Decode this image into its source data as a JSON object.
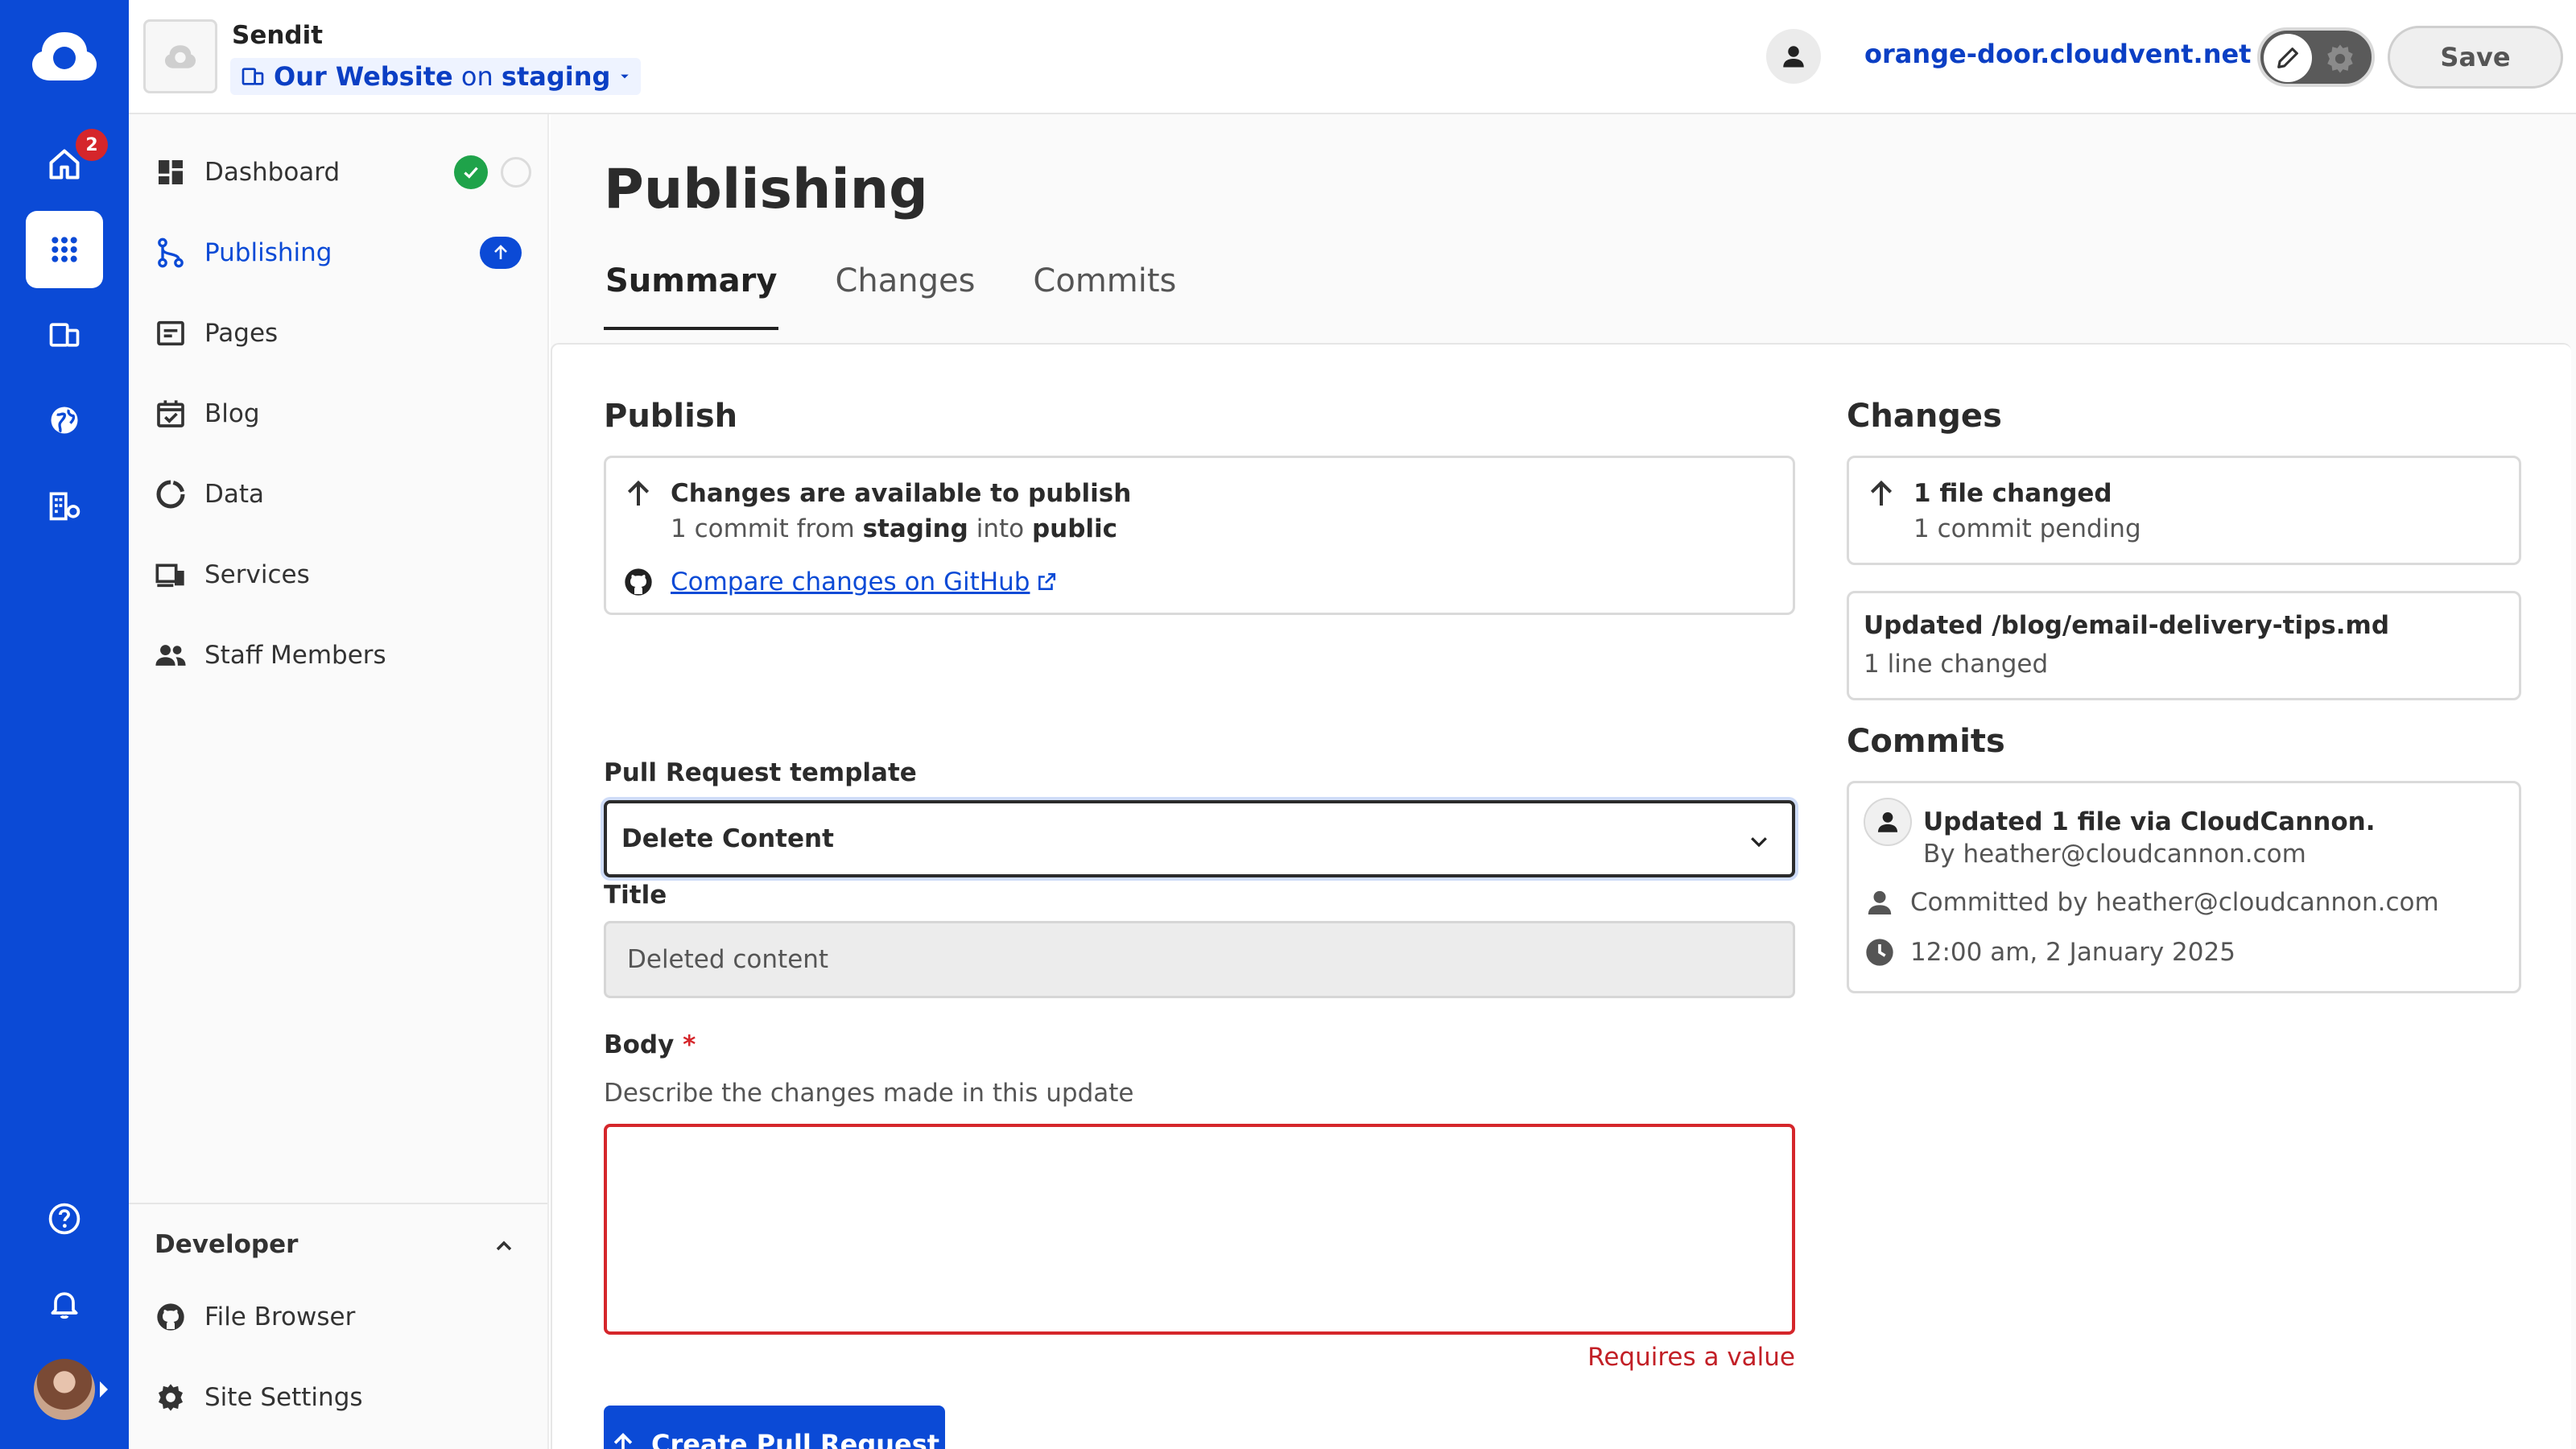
{
  "app": {
    "site_name": "Sendit",
    "site_selector": {
      "website": "Our Website",
      "on": "on",
      "branch": "staging"
    },
    "site_url": "orange-door.cloudvent.net",
    "save_label": "Save",
    "notifications_badge": "2"
  },
  "sidebar": {
    "items": [
      {
        "label": "Dashboard"
      },
      {
        "label": "Publishing"
      },
      {
        "label": "Pages"
      },
      {
        "label": "Blog"
      },
      {
        "label": "Data"
      },
      {
        "label": "Services"
      },
      {
        "label": "Staff Members"
      }
    ],
    "developer": {
      "title": "Developer",
      "items": [
        {
          "label": "File Browser"
        },
        {
          "label": "Site Settings"
        }
      ]
    }
  },
  "main": {
    "title": "Publishing",
    "tabs": [
      {
        "label": "Summary"
      },
      {
        "label": "Changes"
      },
      {
        "label": "Commits"
      }
    ],
    "publish": {
      "title": "Publish",
      "status": "Changes are available to publish",
      "detail": {
        "prefix": "1 commit from",
        "from": "staging",
        "mid": "into",
        "to": "public"
      },
      "compare_link": "Compare changes on GitHub",
      "template_label": "Pull Request template",
      "template_value": "Delete Content",
      "title_label": "Title",
      "title_value": "Deleted content",
      "body_label": "Body",
      "required_mark": "*",
      "body_help": "Describe the changes made in this update",
      "body_value": "",
      "body_error": "Requires a value",
      "submit_label": "Create Pull Request"
    },
    "changes": {
      "title": "Changes",
      "summary": "1 file changed",
      "pending": "1 commit pending",
      "file": "Updated /blog/email-delivery-tips.md",
      "lines": "1 line changed"
    },
    "commits": {
      "title": "Commits",
      "message": "Updated 1 file via CloudCannon.",
      "author": "By heather@cloudcannon.com",
      "committer": "Committed by heather@cloudcannon.com",
      "time": "12:00 am, 2 January 2025"
    }
  }
}
